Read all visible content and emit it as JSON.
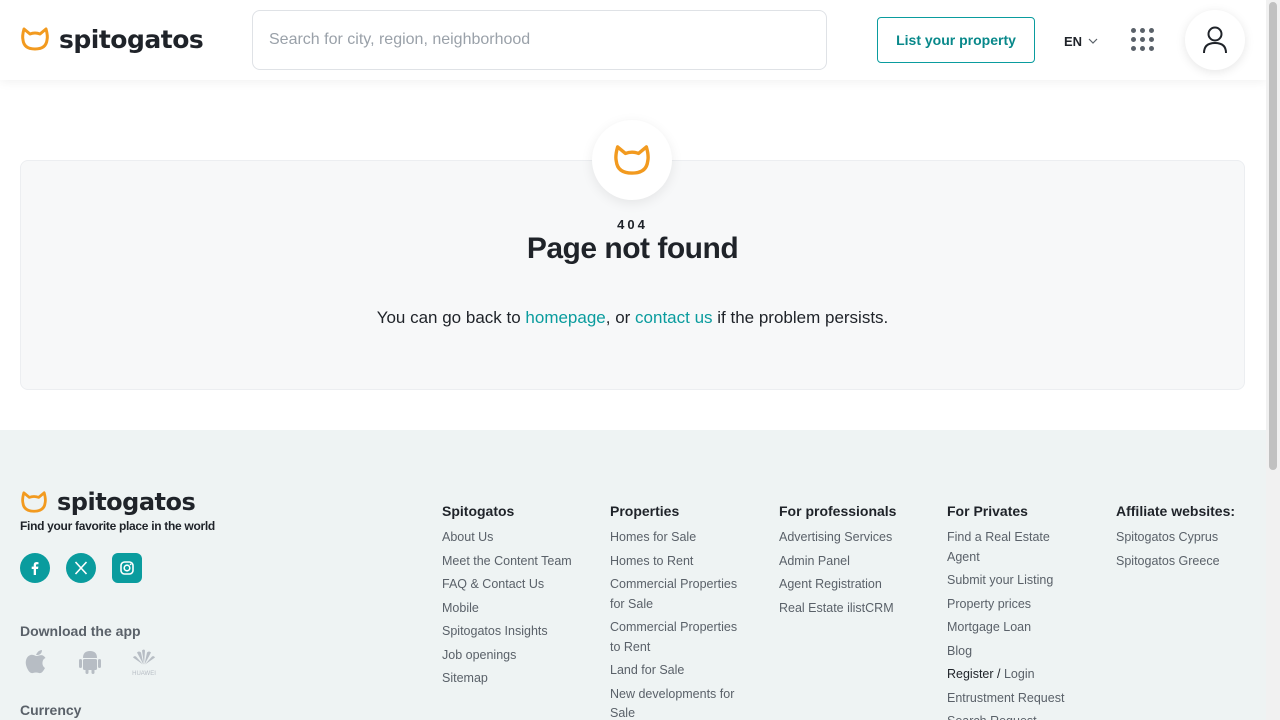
{
  "header": {
    "brand": "spitogatos",
    "search_placeholder": "Search for city, region, neighborhood",
    "list_property": "List your property",
    "language": "EN"
  },
  "error": {
    "code": "404",
    "title": "Page not found",
    "msg_before": "You can go back to ",
    "homepage_link": "homepage",
    "msg_middle": ", or ",
    "contact_link": "contact us",
    "msg_after": " if the problem persists."
  },
  "footer": {
    "brand": "spitogatos",
    "tagline": "Find your favorite place in the world",
    "download_title": "Download the app",
    "huawei_label": "HUAWEI",
    "currency_title": "Currency",
    "columns": [
      {
        "title": "Spitogatos",
        "items": [
          "About Us",
          "Meet the Content Team",
          "FAQ & Contact Us",
          "Mobile",
          "Spitogatos Insights",
          "Job openings",
          "Sitemap"
        ]
      },
      {
        "title": "Properties",
        "items": [
          "Homes for Sale",
          "Homes to Rent",
          "Commercial Properties for Sale",
          "Commercial Properties to Rent",
          "Land for Sale",
          "New developments for Sale"
        ]
      },
      {
        "title": "For professionals",
        "items": [
          "Advertising Services",
          "Admin Panel",
          "Agent Registration",
          "Real Estate ilistCRM"
        ]
      },
      {
        "title": "For Privates",
        "items": [
          "Find a Real Estate Agent",
          "Submit your Listing",
          "Property prices",
          "Mortgage Loan",
          "Blog"
        ],
        "register": "Register",
        "separator": " / ",
        "login": "Login",
        "items_after": [
          "Entrustment Request",
          "Search Request"
        ]
      },
      {
        "title": "Affiliate websites:",
        "items": [
          "Spitogatos Cyprus",
          "Spitogatos Greece"
        ]
      }
    ]
  },
  "colors": {
    "accent": "#0a9c9e",
    "brand_orange": "#f29a1f",
    "footer_bg": "#eef3f3"
  },
  "icons": [
    "cat-logo-icon",
    "chevron-down-icon",
    "apps-grid-icon",
    "user-icon",
    "facebook-icon",
    "x-twitter-icon",
    "instagram-icon",
    "apple-icon",
    "android-icon",
    "huawei-icon"
  ]
}
